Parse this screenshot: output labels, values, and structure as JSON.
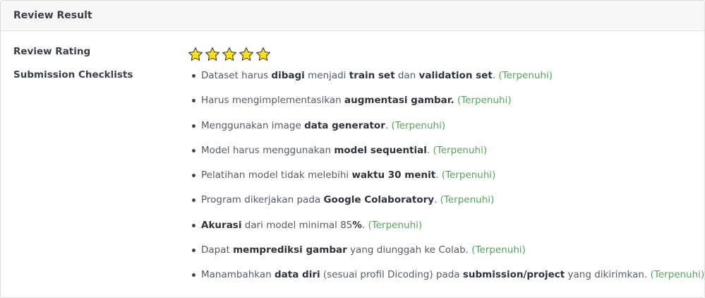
{
  "header": {
    "title": "Review Result"
  },
  "rating": {
    "label": "Review Rating",
    "stars": 5,
    "max": 5,
    "star_color": "#f7e01c"
  },
  "checklist": {
    "label": "Submission Checklists",
    "status_color": "#56a15e",
    "items": [
      {
        "parts": [
          {
            "t": "Dataset harus "
          },
          {
            "t": "dibagi",
            "b": true
          },
          {
            "t": " menjadi "
          },
          {
            "t": "train set",
            "b": true
          },
          {
            "t": " dan "
          },
          {
            "t": "validation set",
            "b": true
          },
          {
            "t": ". "
          }
        ],
        "status": "(Terpenuhi)"
      },
      {
        "parts": [
          {
            "t": "Harus mengimplementasikan "
          },
          {
            "t": "augmentasi gambar.",
            "b": true
          },
          {
            "t": " "
          }
        ],
        "status": "(Terpenuhi)"
      },
      {
        "parts": [
          {
            "t": "Menggunakan image "
          },
          {
            "t": "data generator",
            "b": true
          },
          {
            "t": ". "
          }
        ],
        "status": "(Terpenuhi)"
      },
      {
        "parts": [
          {
            "t": "Model harus menggunakan "
          },
          {
            "t": "model sequential",
            "b": true
          },
          {
            "t": ". "
          }
        ],
        "status": "(Terpenuhi)"
      },
      {
        "parts": [
          {
            "t": "Pelatihan model tidak melebihi "
          },
          {
            "t": "waktu 30 menit",
            "b": true
          },
          {
            "t": ". "
          }
        ],
        "status": "(Terpenuhi)"
      },
      {
        "parts": [
          {
            "t": "Program dikerjakan pada "
          },
          {
            "t": "Google Colaboratory",
            "b": true
          },
          {
            "t": ". "
          }
        ],
        "status": "(Terpenuhi)"
      },
      {
        "parts": [
          {
            "t": "Akurasi",
            "b": true
          },
          {
            "t": " dari model minimal 85"
          },
          {
            "t": "%",
            "b": true
          },
          {
            "t": ". "
          }
        ],
        "status": "(Terpenuhi)"
      },
      {
        "parts": [
          {
            "t": "Dapat "
          },
          {
            "t": "memprediksi gambar",
            "b": true
          },
          {
            "t": " yang diunggah ke Colab. "
          }
        ],
        "status": "(Terpenuhi)"
      },
      {
        "parts": [
          {
            "t": "Manambahkan "
          },
          {
            "t": "data diri",
            "b": true
          },
          {
            "t": " (sesuai profil Dicoding) pada "
          },
          {
            "t": "submission/project",
            "b": true
          },
          {
            "t": " yang dikirimkan. "
          }
        ],
        "status": "(Terpenuhi)"
      }
    ]
  }
}
